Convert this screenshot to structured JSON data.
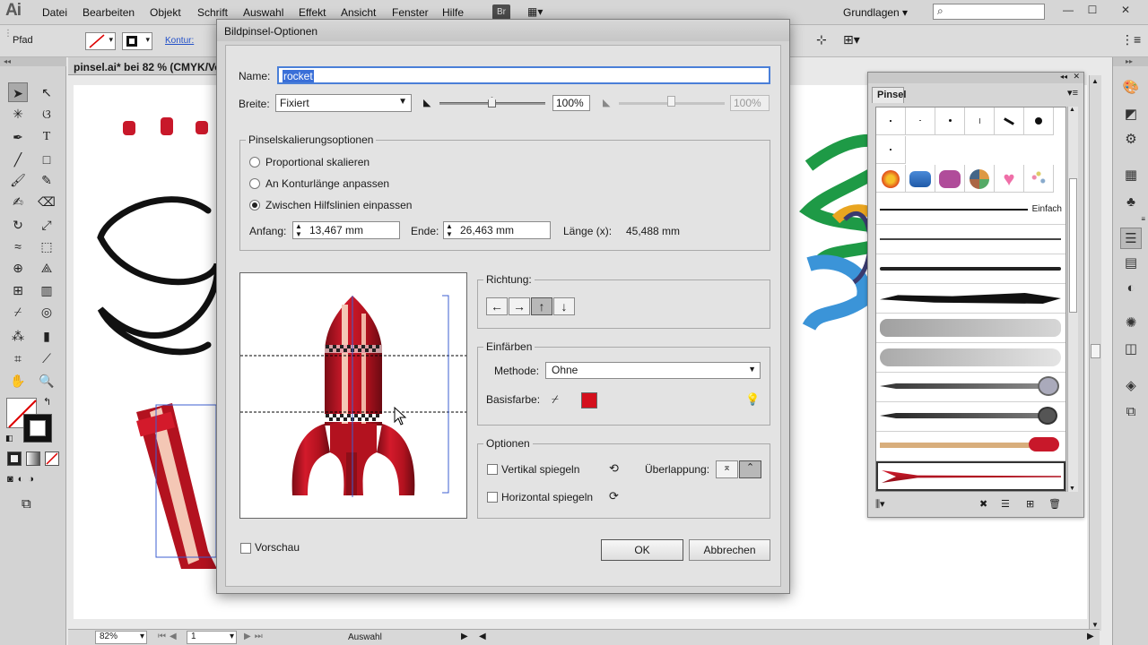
{
  "app": {
    "logo": "Ai"
  },
  "menu": [
    "Datei",
    "Bearbeiten",
    "Objekt",
    "Schrift",
    "Auswahl",
    "Effekt",
    "Ansicht",
    "Fenster",
    "Hilfe"
  ],
  "bridge_button": "Br",
  "workspace": "Grundlagen",
  "search_icon": "search-icon",
  "control_bar": {
    "object_type": "Pfad",
    "stroke_label": "Kontur:"
  },
  "document": {
    "tab": "pinsel.ai* bei 82 % (CMYK/Vor"
  },
  "status": {
    "zoom": "82%",
    "page": "1",
    "tool": "Auswahl"
  },
  "pinsel_panel": {
    "tab": "Pinsel",
    "basic_label": "Einfach"
  },
  "dialog": {
    "title": "Bildpinsel-Optionen",
    "name_label": "Name:",
    "name_value": "rocket",
    "width_label": "Breite:",
    "width_mode": "Fixiert",
    "width_pct": "100%",
    "width_pct2": "100%",
    "scaling": {
      "title": "Pinselskalierungsoptionen",
      "option1": "Proportional skalieren",
      "option2": "An Konturlänge anpassen",
      "option3": "Zwischen Hilfslinien einpassen",
      "selected": "option3",
      "start_label": "Anfang:",
      "start_value": "13,467 mm",
      "end_label": "Ende:",
      "end_value": "26,463 mm",
      "length_label": "Länge (x):",
      "length_value": "45,488 mm"
    },
    "direction": {
      "title": "Richtung:",
      "arrows": [
        "←",
        "→",
        "↑",
        "↓"
      ],
      "active": "↑"
    },
    "colorize": {
      "title": "Einfärben",
      "method_label": "Methode:",
      "method_value": "Ohne",
      "base_label": "Basisfarbe:",
      "base_color": "#d4101d"
    },
    "options": {
      "title": "Optionen",
      "flip_v": "Vertikal spiegeln",
      "flip_h": "Horizontal spiegeln",
      "overlap_label": "Überlappung:"
    },
    "preview_label": "Vorschau",
    "ok": "OK",
    "cancel": "Abbrechen"
  }
}
